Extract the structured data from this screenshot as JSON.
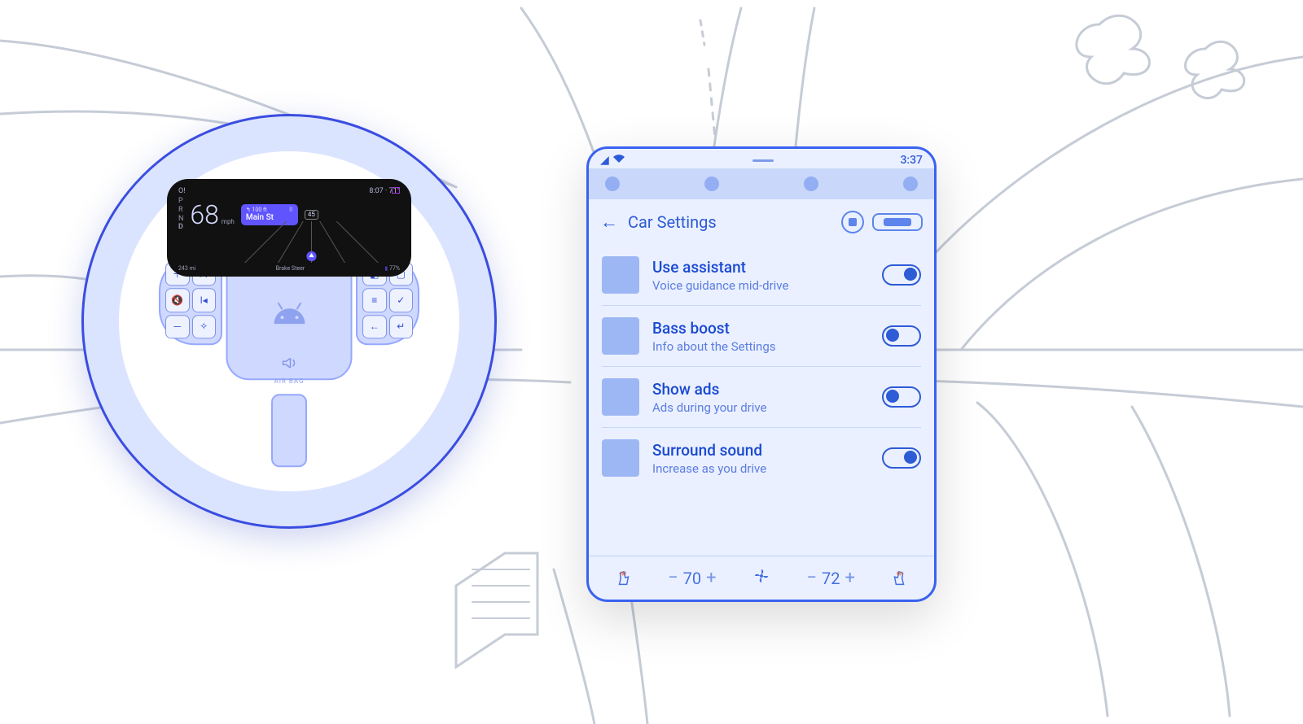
{
  "status_bar": {
    "time": "3:37"
  },
  "page": {
    "title": "Car Settings"
  },
  "settings": [
    {
      "title": "Use assistant",
      "subtitle": "Voice guidance mid-drive",
      "on": true
    },
    {
      "title": "Bass boost",
      "subtitle": "Info about the Settings",
      "on": false
    },
    {
      "title": "Show ads",
      "subtitle": "Ads during your drive",
      "on": false
    },
    {
      "title": "Surround sound",
      "subtitle": "Increase as you drive",
      "on": true
    }
  ],
  "climate": {
    "left_temp": "70",
    "right_temp": "72"
  },
  "cluster": {
    "top_left": "O!",
    "top_right_distance": "100 ft",
    "top_right_weather": "8:07 · 71°",
    "gears": [
      "P",
      "R",
      "N",
      "D"
    ],
    "active_gear": "D",
    "speed": "68",
    "speed_unit": "mph",
    "street": "Main St",
    "limit": "45",
    "bottom_left": "243 mi",
    "bottom_mid": "Brake   Steer",
    "bottom_right": "77%",
    "battery_icon": "▮"
  },
  "wheel": {
    "airbag_label": "AIR BAG"
  }
}
